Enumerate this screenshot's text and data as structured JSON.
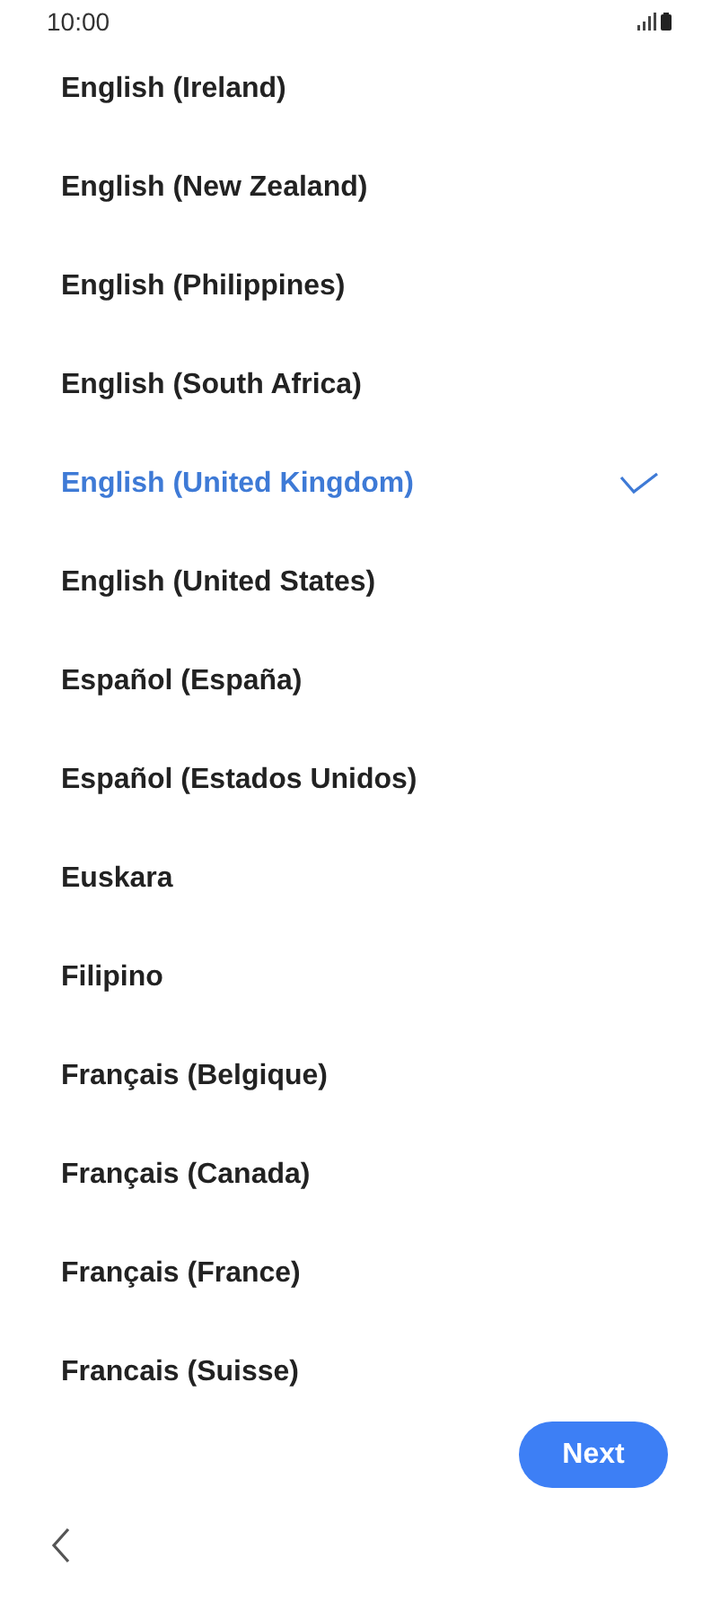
{
  "status_bar": {
    "time": "10:00"
  },
  "languages": [
    {
      "label": "English (Ireland)",
      "selected": false
    },
    {
      "label": "English (New Zealand)",
      "selected": false
    },
    {
      "label": "English (Philippines)",
      "selected": false
    },
    {
      "label": "English (South Africa)",
      "selected": false
    },
    {
      "label": "English (United Kingdom)",
      "selected": true
    },
    {
      "label": "English (United States)",
      "selected": false
    },
    {
      "label": "Español (España)",
      "selected": false
    },
    {
      "label": "Español (Estados Unidos)",
      "selected": false
    },
    {
      "label": "Euskara",
      "selected": false
    },
    {
      "label": "Filipino",
      "selected": false
    },
    {
      "label": "Français (Belgique)",
      "selected": false
    },
    {
      "label": "Français (Canada)",
      "selected": false
    },
    {
      "label": "Français (France)",
      "selected": false
    },
    {
      "label": "Francais (Suisse)",
      "selected": false
    }
  ],
  "next_button": "Next"
}
